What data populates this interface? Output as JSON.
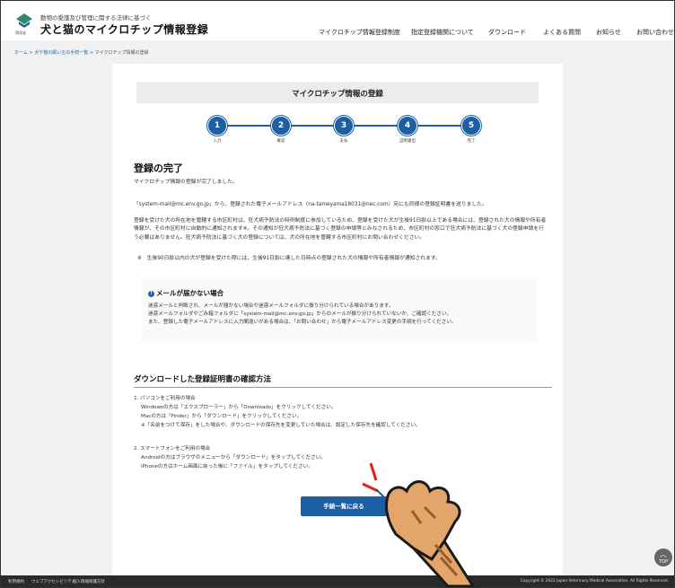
{
  "header": {
    "logo_text": "環境省",
    "subtitle": "動物の愛護及び管理に関する法律に基づく",
    "site_title": "犬と猫のマイクロチップ情報登録",
    "nav": [
      "マイクロチップ情報登録制度",
      "指定登録機関について",
      "ダウンロード",
      "よくある質問",
      "お知らせ",
      "お問い合わせ"
    ]
  },
  "breadcrumb": {
    "home": "ホーム",
    "sep": ">",
    "mid": "犬や猫の飼い主の手続一覧",
    "current": "マイクロチップ情報の登録"
  },
  "page_title": "マイクロチップ情報の登録",
  "steps": [
    {
      "num": "1",
      "label": "入力"
    },
    {
      "num": "2",
      "label": "確認"
    },
    {
      "num": "3",
      "label": "支払"
    },
    {
      "num": "4",
      "label": "証明書出"
    },
    {
      "num": "5",
      "label": "完了"
    }
  ],
  "complete": {
    "heading": "登録の完了",
    "line1": "マイクロチップ情報の登録が完了しました。",
    "line2": "「system-mail@mc.env.go.jp」から、登録された電子メールアドレス（na-tameyama18031@nec.com）宛にも同様の登録証明書を送りました。",
    "para3": "登録を受けた犬の所在地を管轄する市区町村は、狂犬病予防法の特例制度に参加しているため、登録を受けた犬が生後91日齢以上である場合には、登録された犬の情報や所有者情報が、その市区町村に自動的に通知されます※。その通知が狂犬病予防法に基づく登録の申請等とみなされるため、市区町村の窓口で狂犬病予防法に基づく犬の登録申請を行う必要はありません。狂犬病予防法に基づく犬の登録については、犬の所在地を管轄する市区町村にお問い合わせください。",
    "note": "※　生後90日齢以内の犬が登録を受けた際には、生後91日齢に達した日時点の登録された犬の情報や所有者情報が通知されます。"
  },
  "notice": {
    "icon": "!",
    "title": "メールが届かない場合",
    "lines": [
      "迷惑メールと判断され、メールが届かない場合や迷惑メールフォルダに振り分けられている場合があります。",
      "迷惑メールフォルダやごみ箱フォルダに「system-mail@mc.env.go.jp」からのメールが振り分けられていないか、ご確認ください。",
      "また、登録した電子メールアドレスに入力間違いがある場合は、「お問い合わせ」から電子メールアドレス変更の手続を行ってください。"
    ]
  },
  "download": {
    "heading": "ダウンロードした登録証明書の確認方法",
    "pc_title": "1. パソコンをご利用の場合",
    "pc_lines": [
      "Windowsの方は「エクスプローラー」から「Downloads」をクリックしてください。",
      "Macの方は「Finder」から「ダウンロード」をクリックしてください。",
      "※「名前をつけて保存」をした場合や、ダウンロードの保存先を変更していた場合は、設定した保存先を確認してください。"
    ],
    "sp_title": "2. スマートフォンをご利用の場合",
    "sp_lines": [
      "Androidの方はブラウザのメニューから「ダウンロード」をタップしてください。",
      "iPhoneの方はホーム画面に戻った後に「ファイル」をタップしてください。"
    ]
  },
  "return_button": "手続一覧に戻る",
  "top_button": "TOP",
  "footer": {
    "links": [
      "利用規約",
      "ウェブアクセシビリティ",
      "個人情報保護方針"
    ],
    "copyright": "Copyright © 2022 Japan Veterinary Medical Association. All Rights Reserved."
  },
  "colors": {
    "accent": "#1d5fa5",
    "footer_bg": "#2a2a2a",
    "page_bg": "#f1f1f1"
  }
}
